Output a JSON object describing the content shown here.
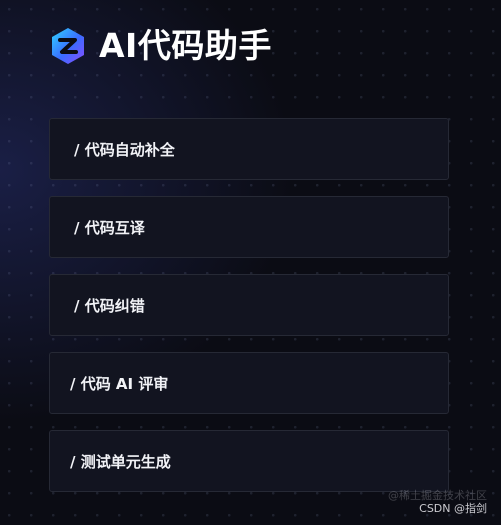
{
  "header": {
    "title": "AI代码助手",
    "logo_icon": "ai-code-assistant-logo-icon"
  },
  "menu": {
    "items": [
      {
        "label": "/ 代码自动补全"
      },
      {
        "label": "/ 代码互译"
      },
      {
        "label": "/ 代码纠错"
      },
      {
        "label": "/ 代码 AI 评审"
      },
      {
        "label": "/ 测试单元生成"
      }
    ]
  },
  "watermark": {
    "faint": "@稀土掘金技术社区",
    "main": "CSDN @指剑"
  },
  "colors": {
    "background": "#0b0c14",
    "card": "#121420",
    "card_border": "#262935",
    "logo_gradient": [
      "#2fd6ff",
      "#3a6bff",
      "#8a4dff"
    ]
  }
}
